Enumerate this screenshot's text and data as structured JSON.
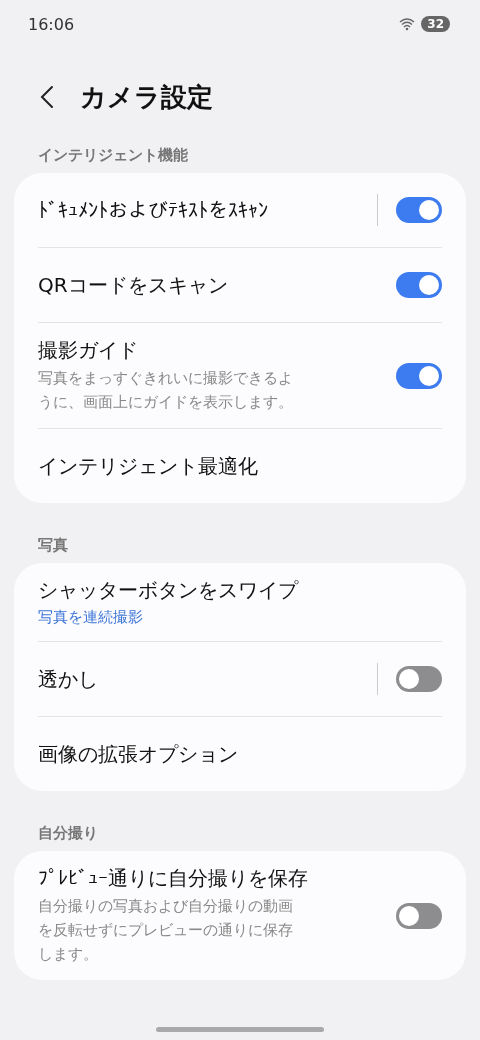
{
  "status_bar": {
    "time": "16:06",
    "battery": "32"
  },
  "header": {
    "title": "カメラ設定"
  },
  "sections": [
    {
      "title": "インテリジェント機能",
      "items": [
        {
          "kind": "toggle",
          "label": "ﾄﾞｷｭﾒﾝﾄおよびﾃｷｽﾄをｽｷｬﾝ",
          "separator": true,
          "on": true
        },
        {
          "kind": "toggle",
          "label": "QRコードをスキャン",
          "separator": false,
          "on": true
        },
        {
          "kind": "toggle",
          "label": "撮影ガイド",
          "description": "写真をまっすぐきれいに撮影できるように、画面上にガイドを表示します。",
          "separator": false,
          "on": true
        },
        {
          "kind": "link",
          "label": "インテリジェント最適化"
        }
      ]
    },
    {
      "title": "写真",
      "items": [
        {
          "kind": "link",
          "label": "シャッターボタンをスワイプ",
          "summary": "写真を連続撮影"
        },
        {
          "kind": "toggle",
          "label": "透かし",
          "separator": true,
          "on": false
        },
        {
          "kind": "link",
          "label": "画像の拡張オプション"
        }
      ]
    },
    {
      "title": "自分撮り",
      "items": [
        {
          "kind": "toggle",
          "label": "ﾌﾟﾚﾋﾞｭｰ通りに自分撮りを保存",
          "description": "自分撮りの写真および自分撮りの動画を反転せずにプレビューの通りに保存します。",
          "separator": false,
          "on": false
        }
      ]
    }
  ]
}
